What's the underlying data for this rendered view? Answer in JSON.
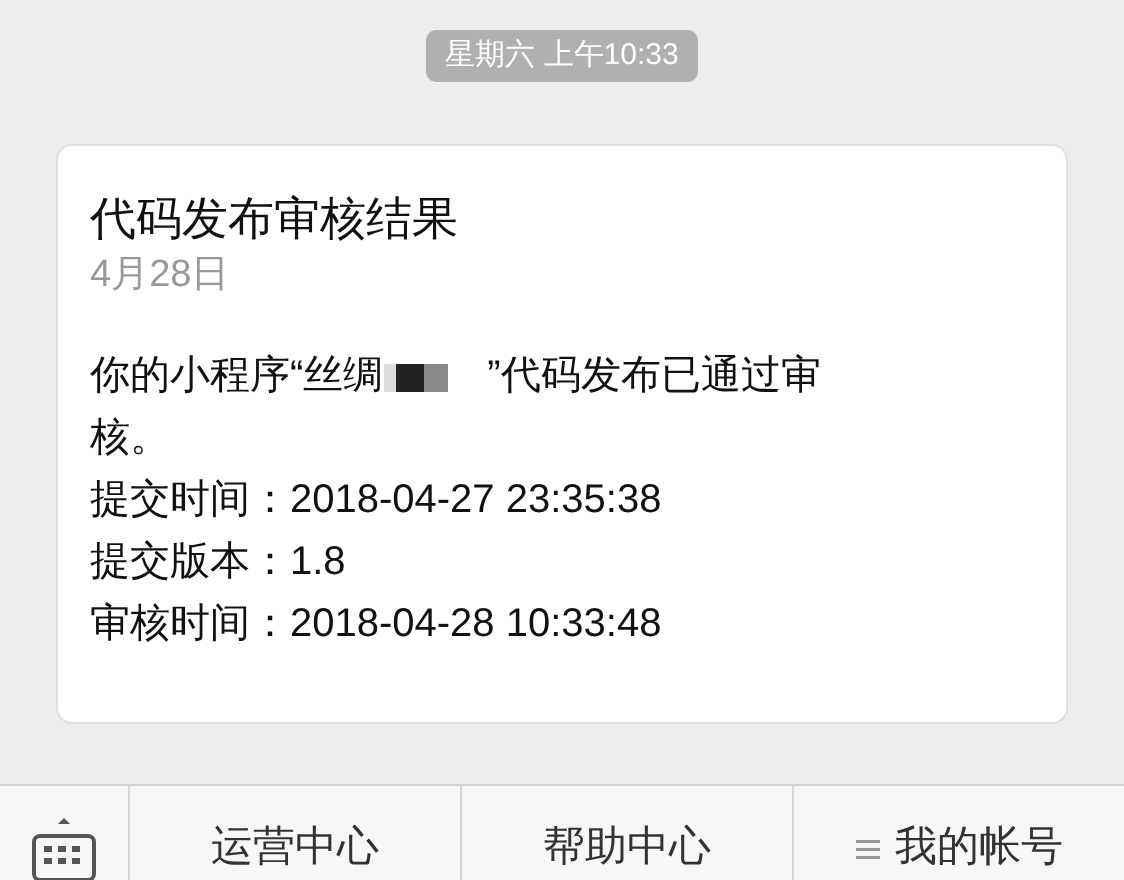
{
  "timestamp": "星期六 上午10:33",
  "card": {
    "title": "代码发布审核结果",
    "date": "4月28日",
    "message_before": "你的小程序“丝绸",
    "message_after": "”代码发布已通过审",
    "message_continued": "核。",
    "details": [
      {
        "label": "提交时间：",
        "value": "2018-04-27 23:35:38"
      },
      {
        "label": "提交版本：",
        "value": "1.8"
      },
      {
        "label": "审核时间：",
        "value": "2018-04-28 10:33:48"
      }
    ]
  },
  "menu": [
    {
      "label": "运营中心",
      "has_list_icon": false
    },
    {
      "label": "帮助中心",
      "has_list_icon": false
    },
    {
      "label": "我的帐号",
      "has_list_icon": true
    }
  ]
}
